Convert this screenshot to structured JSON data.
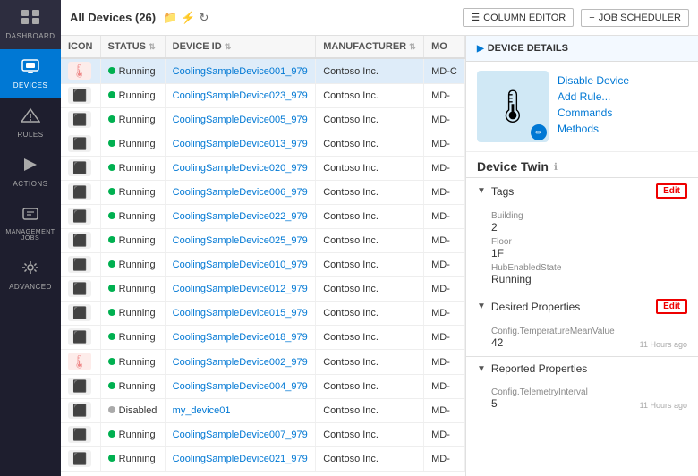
{
  "sidebar": {
    "items": [
      {
        "id": "dashboard",
        "label": "Dashboard",
        "icon": "⊞",
        "active": false
      },
      {
        "id": "devices",
        "label": "Devices",
        "icon": "🖥",
        "active": true
      },
      {
        "id": "rules",
        "label": "Rules",
        "icon": "➤",
        "active": false
      },
      {
        "id": "actions",
        "label": "Actions",
        "icon": "⚡",
        "active": false
      },
      {
        "id": "management_jobs",
        "label": "Management Jobs",
        "icon": "⊟",
        "active": false
      },
      {
        "id": "advanced",
        "label": "Advanced",
        "icon": "🔧",
        "active": false
      }
    ]
  },
  "topbar": {
    "title": "All Devices (26)",
    "column_editor_btn": "COLUMN EDITOR",
    "job_scheduler_btn": "JOB SCHEDULER"
  },
  "table": {
    "columns": [
      "ICON",
      "STATUS",
      "DEVICE ID",
      "MANUFACTURER",
      "MO"
    ],
    "rows": [
      {
        "icon": "🌡",
        "icon_type": "thermometer",
        "status": "Running",
        "device_id": "CoolingSampleDevice001_979",
        "manufacturer": "Contoso Inc.",
        "model": "MD-C",
        "selected": true
      },
      {
        "icon": "⬛",
        "icon_type": "device",
        "status": "Running",
        "device_id": "CoolingSampleDevice023_979",
        "manufacturer": "Contoso Inc.",
        "model": "MD-",
        "selected": false
      },
      {
        "icon": "⬛",
        "icon_type": "device",
        "status": "Running",
        "device_id": "CoolingSampleDevice005_979",
        "manufacturer": "Contoso Inc.",
        "model": "MD-",
        "selected": false
      },
      {
        "icon": "⬛",
        "icon_type": "device",
        "status": "Running",
        "device_id": "CoolingSampleDevice013_979",
        "manufacturer": "Contoso Inc.",
        "model": "MD-",
        "selected": false
      },
      {
        "icon": "⬛",
        "icon_type": "device",
        "status": "Running",
        "device_id": "CoolingSampleDevice020_979",
        "manufacturer": "Contoso Inc.",
        "model": "MD-",
        "selected": false
      },
      {
        "icon": "⬛",
        "icon_type": "device",
        "status": "Running",
        "device_id": "CoolingSampleDevice006_979",
        "manufacturer": "Contoso Inc.",
        "model": "MD-",
        "selected": false
      },
      {
        "icon": "⬛",
        "icon_type": "device",
        "status": "Running",
        "device_id": "CoolingSampleDevice022_979",
        "manufacturer": "Contoso Inc.",
        "model": "MD-",
        "selected": false
      },
      {
        "icon": "⬛",
        "icon_type": "device",
        "status": "Running",
        "device_id": "CoolingSampleDevice025_979",
        "manufacturer": "Contoso Inc.",
        "model": "MD-",
        "selected": false
      },
      {
        "icon": "⬛",
        "icon_type": "device",
        "status": "Running",
        "device_id": "CoolingSampleDevice010_979",
        "manufacturer": "Contoso Inc.",
        "model": "MD-",
        "selected": false
      },
      {
        "icon": "⬛",
        "icon_type": "device",
        "status": "Running",
        "device_id": "CoolingSampleDevice012_979",
        "manufacturer": "Contoso Inc.",
        "model": "MD-",
        "selected": false
      },
      {
        "icon": "⬛",
        "icon_type": "device",
        "status": "Running",
        "device_id": "CoolingSampleDevice015_979",
        "manufacturer": "Contoso Inc.",
        "model": "MD-",
        "selected": false
      },
      {
        "icon": "⬛",
        "icon_type": "device",
        "status": "Running",
        "device_id": "CoolingSampleDevice018_979",
        "manufacturer": "Contoso Inc.",
        "model": "MD-",
        "selected": false
      },
      {
        "icon": "🌡",
        "icon_type": "thermometer",
        "status": "Running",
        "device_id": "CoolingSampleDevice002_979",
        "manufacturer": "Contoso Inc.",
        "model": "MD-",
        "selected": false
      },
      {
        "icon": "⬛",
        "icon_type": "device",
        "status": "Running",
        "device_id": "CoolingSampleDevice004_979",
        "manufacturer": "Contoso Inc.",
        "model": "MD-",
        "selected": false
      },
      {
        "icon": "⬛",
        "icon_type": "device",
        "status": "Disabled",
        "device_id": "my_device01",
        "manufacturer": "Contoso Inc.",
        "model": "MD-",
        "selected": false
      },
      {
        "icon": "⬛",
        "icon_type": "device",
        "status": "Running",
        "device_id": "CoolingSampleDevice007_979",
        "manufacturer": "Contoso Inc.",
        "model": "MD-",
        "selected": false
      },
      {
        "icon": "⬛",
        "icon_type": "device",
        "status": "Running",
        "device_id": "CoolingSampleDevice021_979",
        "manufacturer": "Contoso Inc.",
        "model": "MD-",
        "selected": false
      }
    ]
  },
  "panel": {
    "header": "DEVICE DETAILS",
    "actions": {
      "disable_device": "Disable Device",
      "add_rule": "Add Rule...",
      "commands": "Commands",
      "methods": "Methods"
    },
    "device_twin": {
      "title": "Device Twin",
      "tags_section": {
        "label": "Tags",
        "edit_btn": "Edit",
        "building_label": "Building",
        "building_value": "2",
        "floor_label": "Floor",
        "floor_value": "1F",
        "hub_state_label": "HubEnabledState",
        "hub_state_value": "Running"
      },
      "desired_section": {
        "label": "Desired Properties",
        "edit_btn": "Edit",
        "config_label": "Config.TemperatureMeanValue",
        "config_value": "42",
        "config_time": "11 Hours ago"
      },
      "reported_section": {
        "label": "Reported Properties",
        "telemetry_label": "Config.TelemetryInterval",
        "telemetry_value": "5",
        "telemetry_time": "11 Hours ago"
      }
    }
  }
}
